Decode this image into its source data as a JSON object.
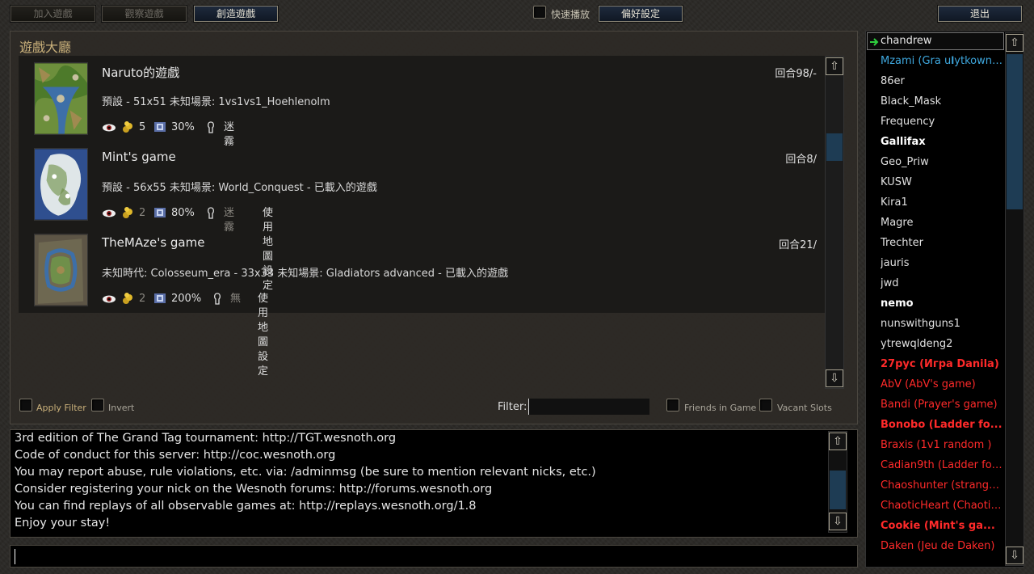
{
  "toolbar": {
    "join_label": "加入遊戲",
    "observe_label": "觀察遊戲",
    "create_label": "創造遊戲",
    "fast_replay_label": "快速播放",
    "preferences_label": "偏好設定",
    "quit_label": "退出"
  },
  "lobby": {
    "title": "遊戲大廳",
    "games": [
      {
        "name": "Naruto的遊戲",
        "turn": "回合98/-",
        "desc": "預設 - 51x51 未知場景: 1vs1vs1_Hoehlenolm",
        "gold": "5",
        "xp": "30%",
        "vision": "迷霧",
        "map_settings": ""
      },
      {
        "name": "Mint's game",
        "turn": "回合8/",
        "desc": "預設 - 56x55 未知場景: World_Conquest - 已載入的遊戲",
        "gold": "2",
        "xp": "80%",
        "vision": "迷霧",
        "map_settings": "使用地圖設定"
      },
      {
        "name": "TheMAze's game",
        "turn": "回合21/",
        "desc": "未知時代: Colosseum_era - 33x33 未知場景: Gladiators advanced - 已載入的遊戲",
        "gold": "2",
        "xp": "200%",
        "vision": "無",
        "map_settings": "使用地圖設定"
      }
    ],
    "filters": {
      "apply_filter": "Apply Filter",
      "invert": "Invert",
      "filter_label": "Filter:",
      "filter_value": "",
      "friends_in_game": "Friends in Game",
      "vacant_slots": "Vacant Slots"
    }
  },
  "chat": {
    "lines": [
      "3rd edition of The Grand Tag tournament: http://TGT.wesnoth.org",
      "Code of conduct for this server: http://coc.wesnoth.org",
      "You may report abuse, rule violations, etc. via: /adminmsg (be sure to mention relevant nicks, etc.)",
      "Consider registering your nick on the Wesnoth forums: http://forums.wesnoth.org",
      "You can find replays of all observable games at: http://replays.wesnoth.org/1.8",
      "Enjoy your stay!"
    ],
    "input_value": ""
  },
  "players": [
    {
      "name": "chandrew",
      "color": "#e8e8e8",
      "bold": false
    },
    {
      "name": "Mzami (Gra u𝐈ytkownik...",
      "color": "#3fa9e0",
      "bold": false
    },
    {
      "name": "86er",
      "color": "#e0e0e0",
      "bold": false
    },
    {
      "name": "Black_Mask",
      "color": "#e0e0e0",
      "bold": false
    },
    {
      "name": "Frequency",
      "color": "#e0e0e0",
      "bold": false
    },
    {
      "name": "Gallifax",
      "color": "#ffffff",
      "bold": true
    },
    {
      "name": "Geo_Priw",
      "color": "#e0e0e0",
      "bold": false
    },
    {
      "name": "KUSW",
      "color": "#e0e0e0",
      "bold": false
    },
    {
      "name": "Kira1",
      "color": "#e0e0e0",
      "bold": false
    },
    {
      "name": "Magre",
      "color": "#e0e0e0",
      "bold": false
    },
    {
      "name": "Trechter",
      "color": "#e0e0e0",
      "bold": false
    },
    {
      "name": "jauris",
      "color": "#e0e0e0",
      "bold": false
    },
    {
      "name": "jwd",
      "color": "#e0e0e0",
      "bold": false
    },
    {
      "name": "nemo",
      "color": "#ffffff",
      "bold": true
    },
    {
      "name": "nunswithguns1",
      "color": "#e0e0e0",
      "bold": false
    },
    {
      "name": "ytrewqldeng2",
      "color": "#e0e0e0",
      "bold": false
    },
    {
      "name": "27рус (Игра Danila)",
      "color": "#ff2a2a",
      "bold": true
    },
    {
      "name": "AbV (AbV's game)",
      "color": "#ff2a2a",
      "bold": false
    },
    {
      "name": "Bandi (Prayer's game)",
      "color": "#ff2a2a",
      "bold": false
    },
    {
      "name": "Bonobo (Ladder fo...",
      "color": "#ff2a2a",
      "bold": true
    },
    {
      "name": "Braxis (1v1 random )",
      "color": "#ff2a2a",
      "bold": false
    },
    {
      "name": "Cadian9th (Ladder for...",
      "color": "#ff2a2a",
      "bold": false
    },
    {
      "name": "Chaoshunter (strange...",
      "color": "#ff2a2a",
      "bold": false
    },
    {
      "name": "ChaoticHeart (Chaotic...",
      "color": "#ff2a2a",
      "bold": false
    },
    {
      "name": "Cookie (Mint's ga...",
      "color": "#ff2a2a",
      "bold": true
    },
    {
      "name": "Daken (Jeu de Daken)",
      "color": "#ff2a2a",
      "bold": false
    }
  ]
}
